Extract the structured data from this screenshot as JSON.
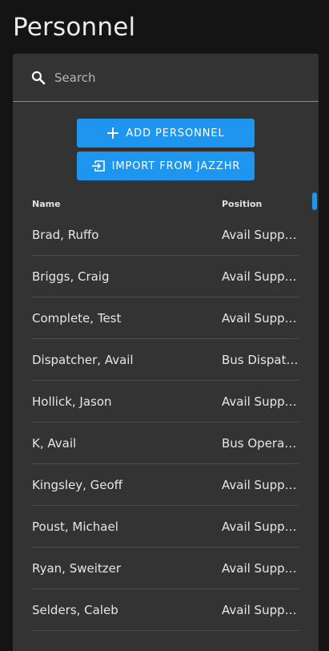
{
  "page": {
    "title": "Personnel"
  },
  "search": {
    "placeholder": "Search"
  },
  "actions": {
    "add_label": "ADD PERSONNEL",
    "import_label": "IMPORT FROM JAZZHR"
  },
  "table": {
    "headers": {
      "name": "Name",
      "position": "Position"
    },
    "rows": [
      {
        "name": "Brad, Ruffo",
        "position": "Avail Support"
      },
      {
        "name": "Briggs, Craig",
        "position": "Avail Support"
      },
      {
        "name": "Complete, Test",
        "position": "Avail Support"
      },
      {
        "name": "Dispatcher, Avail",
        "position": "Bus Dispatcher"
      },
      {
        "name": "Hollick, Jason",
        "position": "Avail Support"
      },
      {
        "name": "K, Avail",
        "position": "Bus Operator"
      },
      {
        "name": "Kingsley, Geoff",
        "position": "Avail Support"
      },
      {
        "name": "Poust, Michael",
        "position": "Avail Support"
      },
      {
        "name": "Ryan, Sweitzer",
        "position": "Avail Support"
      },
      {
        "name": "Selders, Caleb",
        "position": "Avail Support"
      }
    ]
  },
  "colors": {
    "background": "#141414",
    "panel": "#333333",
    "accent": "#1e96f0"
  },
  "icons": {
    "search": "search-icon",
    "add": "plus-icon",
    "import": "import-icon"
  }
}
